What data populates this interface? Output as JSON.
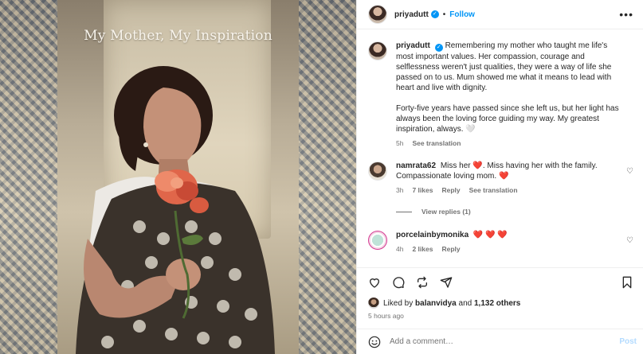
{
  "photo": {
    "overlay_text": "My Mother, My Inspiration"
  },
  "header": {
    "username": "priyadutt",
    "separator": "•",
    "follow_label": "Follow",
    "more_label": "•••"
  },
  "caption": {
    "username": "priyadutt",
    "paragraph1": "Remembering my mother who taught me life's most important values. Her compassion, courage and selflessness weren't just qualities, they were a way of life she passed on to us. Mum showed me what it means to lead with heart and live with dignity.",
    "paragraph2": "Forty-five years have passed since she left us, but her light has always been the loving force guiding my way. My greatest inspiration, always.",
    "paragraph2_emoji": "🤍",
    "time": "5h",
    "see_translation": "See translation"
  },
  "comments": [
    {
      "username": "namrata62",
      "text_a": "Miss her",
      "emoji_a": "❤️",
      "text_b": ". Miss having her with the family. Compassionate loving mom.",
      "emoji_b": "❤️",
      "time": "3h",
      "likes": "7 likes",
      "reply": "Reply",
      "see_translation": "See translation",
      "view_replies": "View replies (1)"
    },
    {
      "username": "porcelainbymonika",
      "text": "❤️ ❤️ ❤️",
      "time": "4h",
      "likes": "2 likes",
      "reply": "Reply"
    }
  ],
  "likes": {
    "prefix": "Liked by",
    "user": "balanvidya",
    "connector": "and",
    "others": "1,132 others"
  },
  "timestamp": "5 hours ago",
  "add_comment": {
    "placeholder": "Add a comment…",
    "post_label": "Post"
  },
  "colors": {
    "accent": "#0095f6",
    "heart": "#ed4956",
    "muted": "#737373"
  },
  "icons": [
    "heart-icon",
    "comment-icon",
    "share-icon",
    "bookmark-icon",
    "emoji-icon",
    "verified-icon"
  ]
}
